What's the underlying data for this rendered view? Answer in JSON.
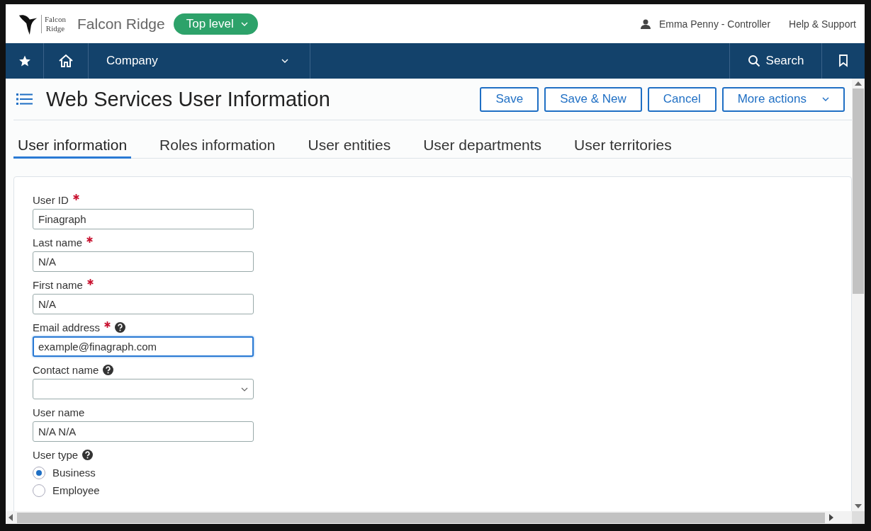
{
  "header": {
    "logo_lines": [
      "Falcon",
      "Ridge"
    ],
    "company": "Falcon Ridge",
    "level_button": "Top level",
    "user": "Emma Penny - Controller",
    "help": "Help & Support"
  },
  "nav": {
    "menu": "Company",
    "search": "Search"
  },
  "page": {
    "title": "Web Services User Information",
    "actions": [
      {
        "label": "Save",
        "dropdown": false
      },
      {
        "label": "Save & New",
        "dropdown": false
      },
      {
        "label": "Cancel",
        "dropdown": false
      },
      {
        "label": "More actions",
        "dropdown": true
      }
    ]
  },
  "tabs": [
    {
      "label": "User information",
      "selected": true
    },
    {
      "label": "Roles information",
      "selected": false
    },
    {
      "label": "User entities",
      "selected": false
    },
    {
      "label": "User departments",
      "selected": false
    },
    {
      "label": "User territories",
      "selected": false
    }
  ],
  "fields": [
    {
      "kind": "text",
      "label": "User ID",
      "required": true,
      "help": false,
      "value": "Finagraph",
      "focused": false
    },
    {
      "kind": "text",
      "label": "Last name",
      "required": true,
      "help": false,
      "value": "N/A",
      "focused": false
    },
    {
      "kind": "text",
      "label": "First name",
      "required": true,
      "help": false,
      "value": "N/A",
      "focused": false
    },
    {
      "kind": "text",
      "label": "Email address",
      "required": true,
      "help": true,
      "value": "example@finagraph.com",
      "focused": true
    },
    {
      "kind": "select",
      "label": "Contact name",
      "required": false,
      "help": true,
      "focused": false
    },
    {
      "kind": "text",
      "label": "User name",
      "required": false,
      "help": false,
      "value": "N/A N/A",
      "focused": false
    },
    {
      "kind": "radio",
      "label": "User type",
      "required": false,
      "help": true,
      "options": [
        {
          "label": "Business",
          "selected": true
        },
        {
          "label": "Employee",
          "selected": false
        }
      ]
    }
  ]
}
